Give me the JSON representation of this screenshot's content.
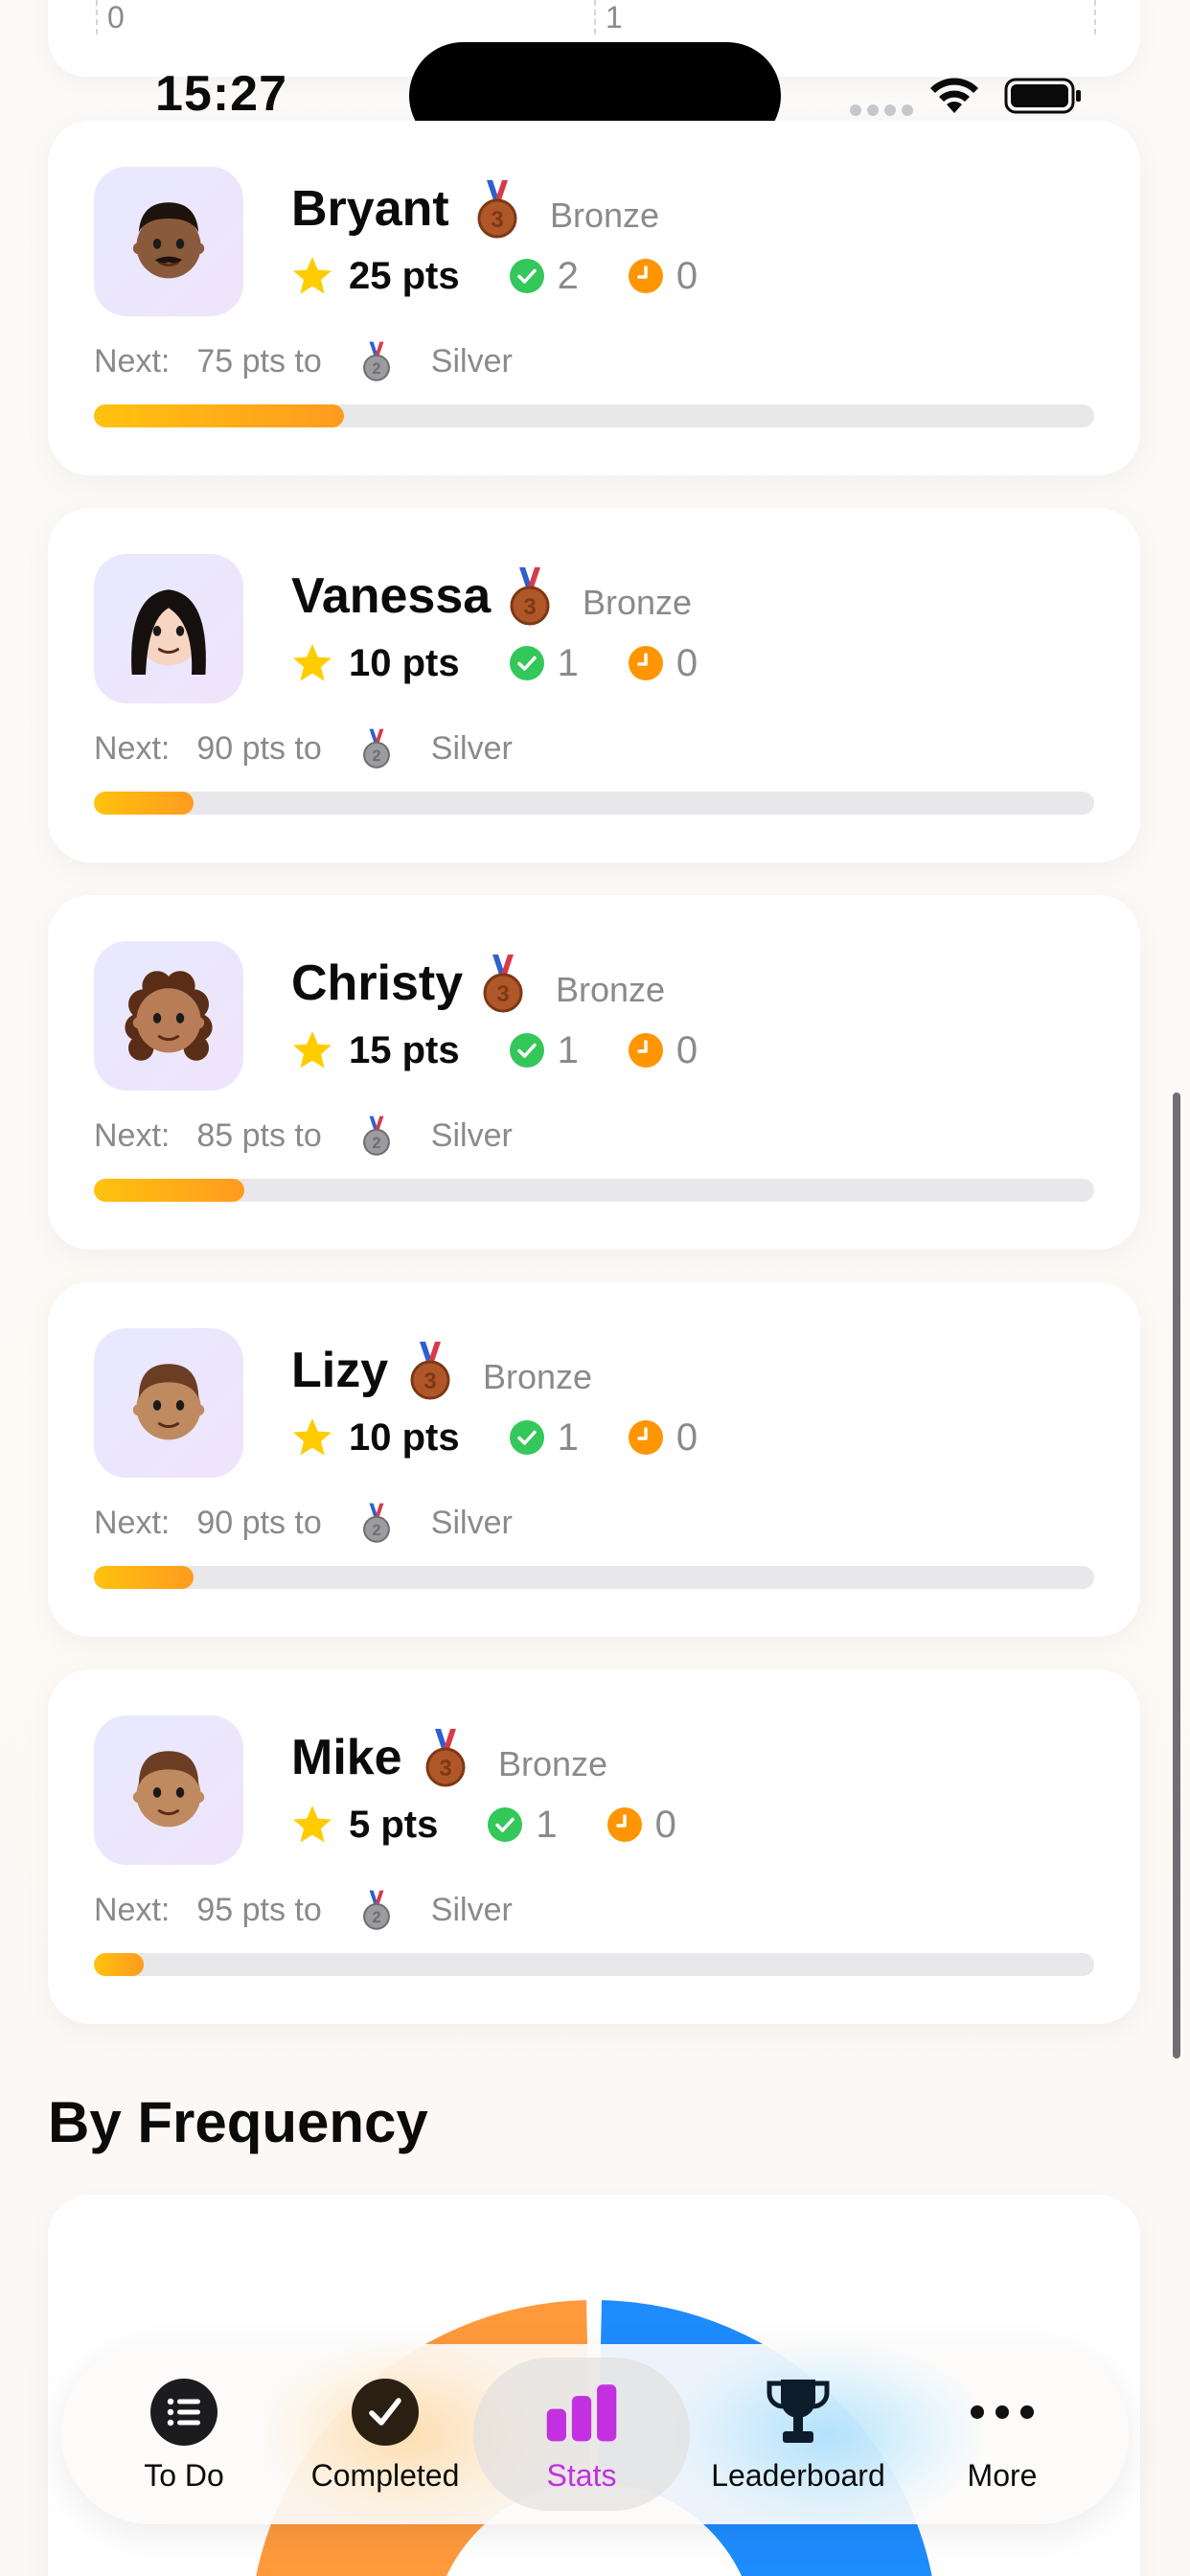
{
  "status_bar": {
    "time": "15:27"
  },
  "top_chart": {
    "tick_0": "0",
    "tick_1": "1"
  },
  "members": [
    {
      "name": "Bryant",
      "avatar": "man-dark-skin-mustache-emoji",
      "tier": "Bronze",
      "medal": "3",
      "points": "25 pts",
      "completed": "2",
      "pending": "0",
      "next_label": "Next:",
      "next_text": "75 pts to",
      "next_medal": "2",
      "next_tier": "Silver",
      "progress": 0.25
    },
    {
      "name": "Vanessa",
      "avatar": "woman-long-dark-hair-emoji",
      "tier": "Bronze",
      "medal": "3",
      "points": "10 pts",
      "completed": "1",
      "pending": "0",
      "next_label": "Next:",
      "next_text": "90 pts to",
      "next_medal": "2",
      "next_tier": "Silver",
      "progress": 0.1
    },
    {
      "name": "Christy",
      "avatar": "woman-curly-hair-emoji",
      "tier": "Bronze",
      "medal": "3",
      "points": "15 pts",
      "completed": "1",
      "pending": "0",
      "next_label": "Next:",
      "next_text": "85 pts to",
      "next_medal": "2",
      "next_tier": "Silver",
      "progress": 0.15
    },
    {
      "name": "Lizy",
      "avatar": "child-emoji",
      "tier": "Bronze",
      "medal": "3",
      "points": "10 pts",
      "completed": "1",
      "pending": "0",
      "next_label": "Next:",
      "next_text": "90 pts to",
      "next_medal": "2",
      "next_tier": "Silver",
      "progress": 0.1
    },
    {
      "name": "Mike",
      "avatar": "boy-emoji",
      "tier": "Bronze",
      "medal": "3",
      "points": "5 pts",
      "completed": "1",
      "pending": "0",
      "next_label": "Next:",
      "next_text": "95 pts to",
      "next_medal": "2",
      "next_tier": "Silver",
      "progress": 0.05
    }
  ],
  "section": {
    "title": "By Frequency"
  },
  "chart_data": {
    "type": "pie",
    "title": "",
    "segments": [
      {
        "color": "#ff9a3c"
      },
      {
        "color": "#1e8cff"
      }
    ]
  },
  "colors": {
    "accent": "#c330e0",
    "progress_start": "#ffc20e",
    "progress_end": "#ff9b1f",
    "check": "#34c759",
    "pending": "#ff9500",
    "star": "#ffcc00"
  },
  "tabs": [
    {
      "label": "To Do",
      "icon": "list-icon",
      "active": false
    },
    {
      "label": "Completed",
      "icon": "checkmark-circle-icon",
      "active": false
    },
    {
      "label": "Stats",
      "icon": "bar-chart-icon",
      "active": true
    },
    {
      "label": "Leaderboard",
      "icon": "trophy-icon",
      "active": false
    },
    {
      "label": "More",
      "icon": "ellipsis-icon",
      "active": false
    }
  ]
}
